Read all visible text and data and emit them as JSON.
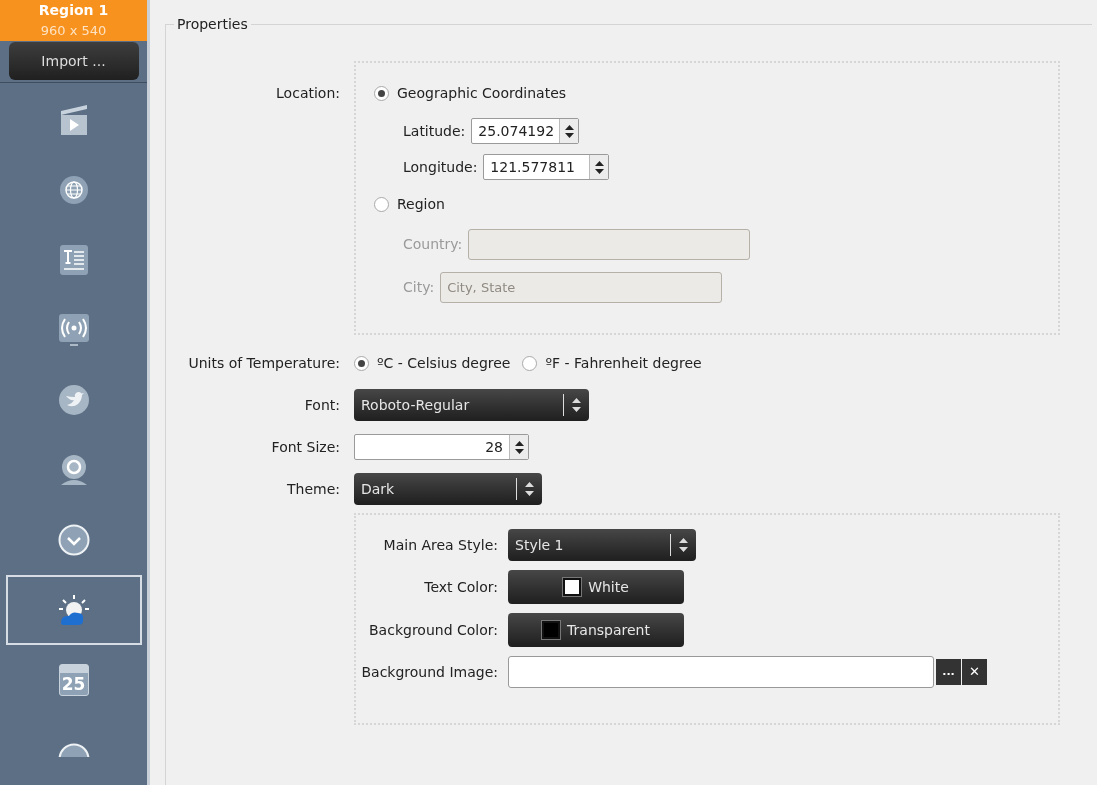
{
  "sidebar": {
    "region": {
      "title": "Region 1",
      "size": "960 x 540"
    },
    "import_button": "Import ...",
    "items": [
      {
        "kind": "video",
        "selected": false
      },
      {
        "kind": "web",
        "selected": false
      },
      {
        "kind": "text",
        "selected": false
      },
      {
        "kind": "broadcast",
        "selected": false
      },
      {
        "kind": "bird",
        "selected": false
      },
      {
        "kind": "webcam",
        "selected": false
      },
      {
        "kind": "clock",
        "selected": false
      },
      {
        "kind": "weather",
        "selected": true
      },
      {
        "kind": "calendar",
        "selected": false,
        "label": "25"
      },
      {
        "kind": "circle",
        "selected": false
      }
    ]
  },
  "properties": {
    "title": "Properties",
    "location": {
      "label": "Location:",
      "options": [
        {
          "label": "Geographic Coordinates",
          "selected": true
        },
        {
          "label": "Region",
          "selected": false
        }
      ],
      "latitude": {
        "label": "Latitude:",
        "value": "25.074192"
      },
      "longitude": {
        "label": "Longitude:",
        "value": "121.577811"
      },
      "country": {
        "label": "Country:",
        "disabled": true
      },
      "city": {
        "label": "City:",
        "placeholder": "City, State",
        "disabled": true
      }
    },
    "units": {
      "label": "Units of Temperature:",
      "options": [
        {
          "label": "ºC - Celsius degree",
          "selected": true
        },
        {
          "label": "ºF - Fahrenheit degree",
          "selected": false
        }
      ]
    },
    "font": {
      "label": "Font:",
      "value": "Roboto-Regular"
    },
    "font_size": {
      "label": "Font Size:",
      "value": "28"
    },
    "theme": {
      "label": "Theme:",
      "value": "Dark"
    },
    "main_area_style": {
      "label": "Main Area Style:",
      "value": "Style 1"
    },
    "text_color": {
      "label": "Text Color:",
      "value": "White",
      "color": "#ffffff"
    },
    "background_color": {
      "label": "Background Color:",
      "value": "Transparent",
      "color": "#000000"
    },
    "background_image": {
      "label": "Background Image:",
      "browse": "...",
      "clear": "✕"
    }
  }
}
